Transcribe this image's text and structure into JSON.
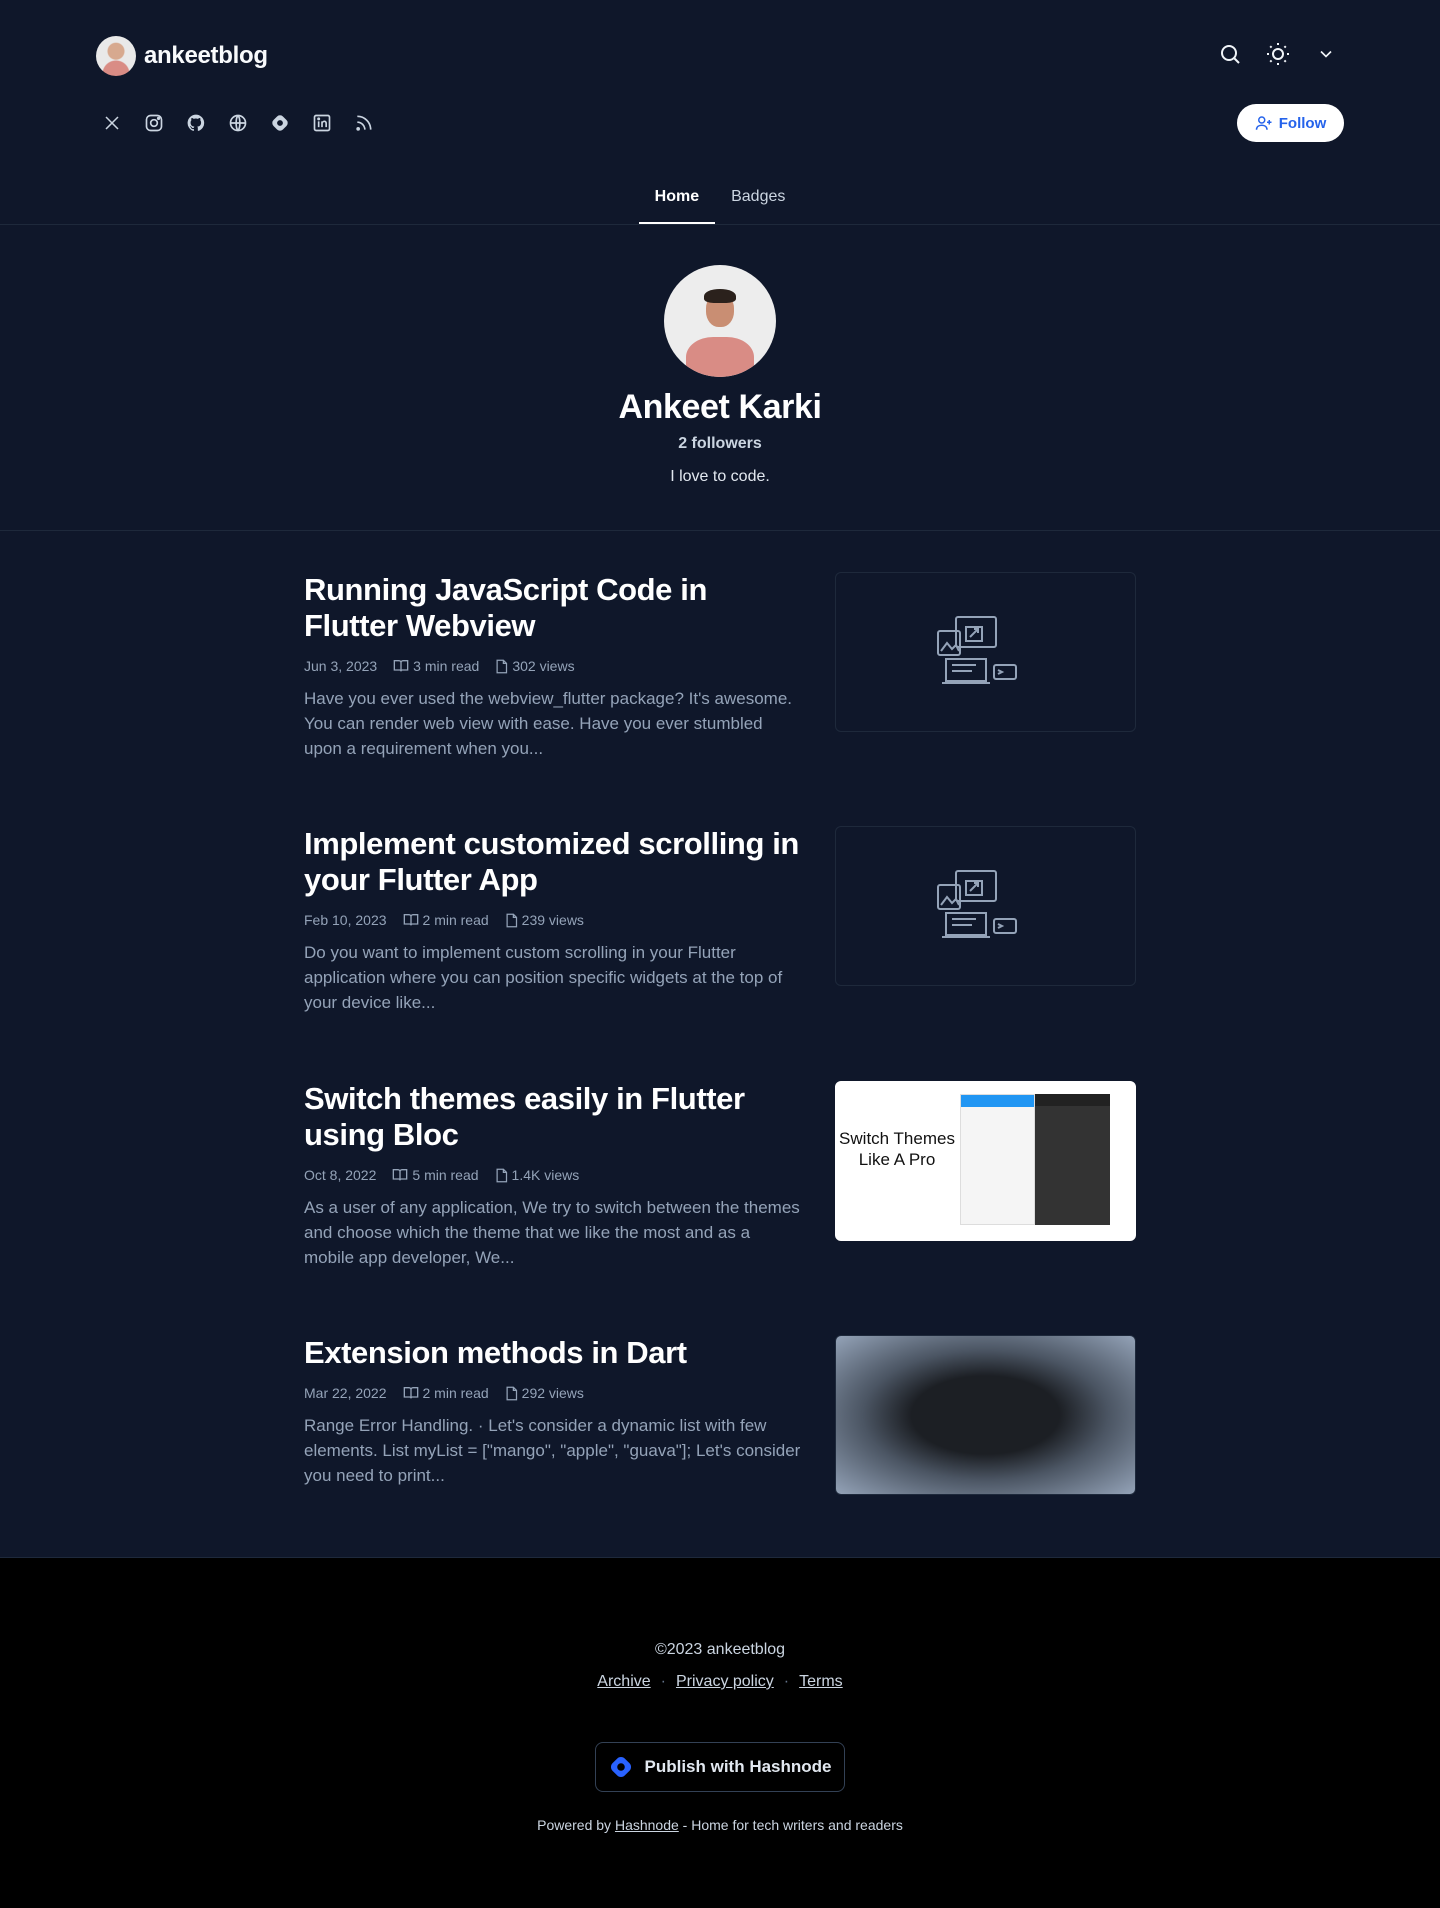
{
  "brand": {
    "name": "ankeetblog"
  },
  "header": {
    "actions": [
      "search-icon",
      "sun-icon",
      "chevron-down-icon"
    ],
    "socials": [
      "x-icon",
      "instagram-icon",
      "github-icon",
      "globe-icon",
      "hashnode-icon",
      "linkedin-icon",
      "rss-icon"
    ],
    "follow_label": "Follow"
  },
  "nav": {
    "tabs": [
      {
        "label": "Home",
        "active": true
      },
      {
        "label": "Badges",
        "active": false
      }
    ]
  },
  "profile": {
    "name": "Ankeet Karki",
    "followers": "2 followers",
    "bio": "I love to code."
  },
  "posts": [
    {
      "title": "Running JavaScript Code in Flutter Webview",
      "date": "Jun 3, 2023",
      "read_time": "3 min read",
      "views": "302 views",
      "excerpt": "Have you ever used the webview_flutter package? It's awesome. You can render web view with ease. Have you ever stumbled upon a requirement when you..."
    },
    {
      "title": "Implement customized scrolling in your Flutter App",
      "date": "Feb 10, 2023",
      "read_time": "2 min read",
      "views": "239 views",
      "excerpt": "Do you want to implement custom scrolling in your Flutter application where you can position specific widgets at the top of your device like..."
    },
    {
      "title": "Switch themes easily in Flutter using Bloc",
      "date": "Oct 8, 2022",
      "read_time": "5 min read",
      "views": "1.4K views",
      "excerpt": "As a user of any application, We try to switch between the themes and choose which the theme that we like the most and as a mobile app developer, We...",
      "thumb_text": "Switch Themes Like A Pro"
    },
    {
      "title": "Extension methods in Dart",
      "date": "Mar 22, 2022",
      "read_time": "2 min read",
      "views": "292 views",
      "excerpt": "Range Error Handling. · Let's consider a dynamic list with few elements. List myList = [\"mango\", \"apple\", \"guava\"]; Let's consider you need to print..."
    }
  ],
  "footer": {
    "copyright": "©2023 ankeetblog",
    "links": [
      "Archive",
      "Privacy policy",
      "Terms"
    ],
    "separator": "·",
    "publish_label": "Publish with Hashnode",
    "powered_prefix": "Powered by",
    "powered_link": "Hashnode",
    "powered_suffix": "- Home for tech writers and readers"
  },
  "colors": {
    "background": "#0f172a",
    "footer": "#000000",
    "accent": "#2563eb",
    "muted": "#94a3b8"
  }
}
